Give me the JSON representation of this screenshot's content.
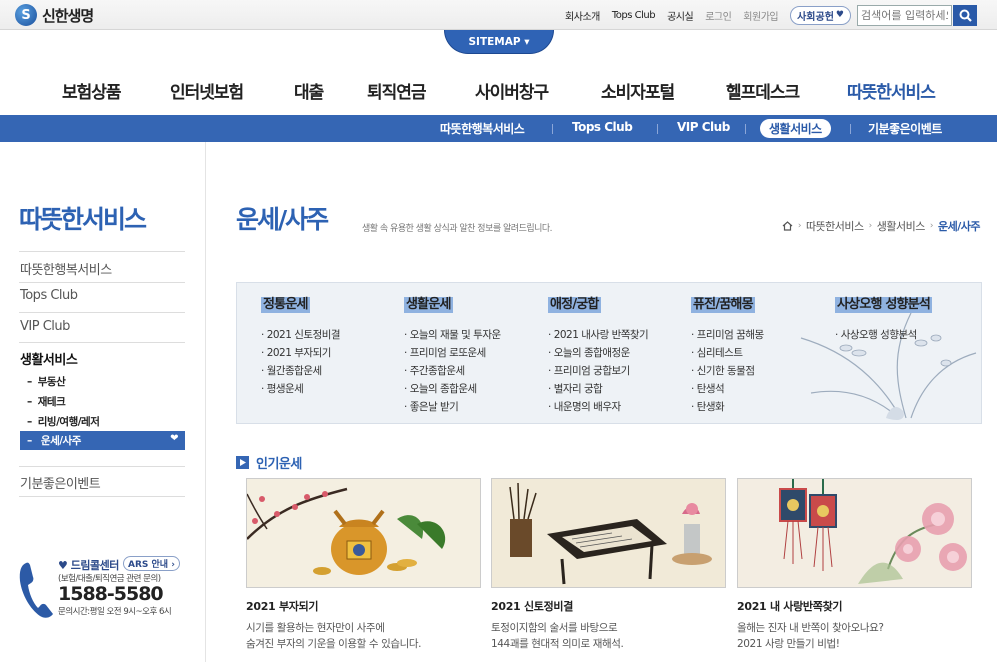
{
  "header": {
    "logo_text": "신한생명",
    "util_links": [
      "회사소개",
      "Tops Club",
      "공시실"
    ],
    "login": "로그인",
    "join": "회원가입",
    "social": "사회공헌",
    "search_placeholder": "검색어를 입력하세요",
    "sitemap": "SITEMAP ▾"
  },
  "main_nav": [
    "보험상품",
    "인터넷보험",
    "대출",
    "퇴직연금",
    "사이버창구",
    "소비자포털",
    "헬프데스크",
    "따뜻한서비스"
  ],
  "sub_nav": [
    "따뜻한행복서비스",
    "Tops Club",
    "VIP Club",
    "생활서비스",
    "기분좋은이벤트"
  ],
  "sidebar": {
    "title": "따뜻한서비스",
    "items": [
      "따뜻한행복서비스",
      "Tops Club",
      "VIP Club",
      "생활서비스",
      "기분좋은이벤트"
    ],
    "subitems": [
      "부동산",
      "재테크",
      "리빙/여행/레저",
      "운세/사주"
    ]
  },
  "callcenter": {
    "title": "드림콜센터",
    "ars": "ARS 안내 ›",
    "desc": "(보험/대출/퇴직연금 관련 문의)",
    "number": "1588-5580",
    "hours": "문의시간:평일 오전 9시~오후 6시"
  },
  "page": {
    "title": "운세/사주",
    "description": "생활 속 유용한 생활 상식과 알찬 정보를 알려드립니다.",
    "breadcrumb": [
      "따뜻한서비스",
      "생활서비스",
      "운세/사주"
    ]
  },
  "fortune_menu": [
    {
      "head": "정통운세",
      "items": [
        "2021 신토정비결",
        "2021 부자되기",
        "월간종합운세",
        "평생운세"
      ]
    },
    {
      "head": "생활운세",
      "items": [
        "오늘의 재물 및 투자운",
        "프리미엄 로또운세",
        "주간종합운세",
        "오늘의 종합운세",
        "좋은날 받기"
      ]
    },
    {
      "head": "애정/궁합",
      "items": [
        "2021 내사랑 반쪽찾기",
        "오늘의 종합애정운",
        "프리미엄 궁합보기",
        "별자리 궁합",
        "내운명의 배우자"
      ]
    },
    {
      "head": "퓨전/꿈해몽",
      "items": [
        "프리미엄 꿈해몽",
        "심리테스트",
        "신기한 동물점",
        "탄생석",
        "탄생화"
      ]
    },
    {
      "head": "사상오행 성향분석",
      "items": [
        "사상오행 성향분석"
      ]
    }
  ],
  "popular": {
    "title": "인기운세",
    "cards": [
      {
        "title": "2021 부자되기",
        "desc": "시기를 활용하는 현자만이 사주에\n숨겨진 부자의 기운을 이용할 수 있습니다."
      },
      {
        "title": "2021 신토정비결",
        "desc": "토정이지함의 술서를 바탕으로\n144괘를 현대적 의미로 재해석."
      },
      {
        "title": "2021 내 사랑반쪽찾기",
        "desc": "올해는 진자 내 반쪽이 찾아오나요?\n2021 사랑 만들기 비법!"
      }
    ]
  }
}
